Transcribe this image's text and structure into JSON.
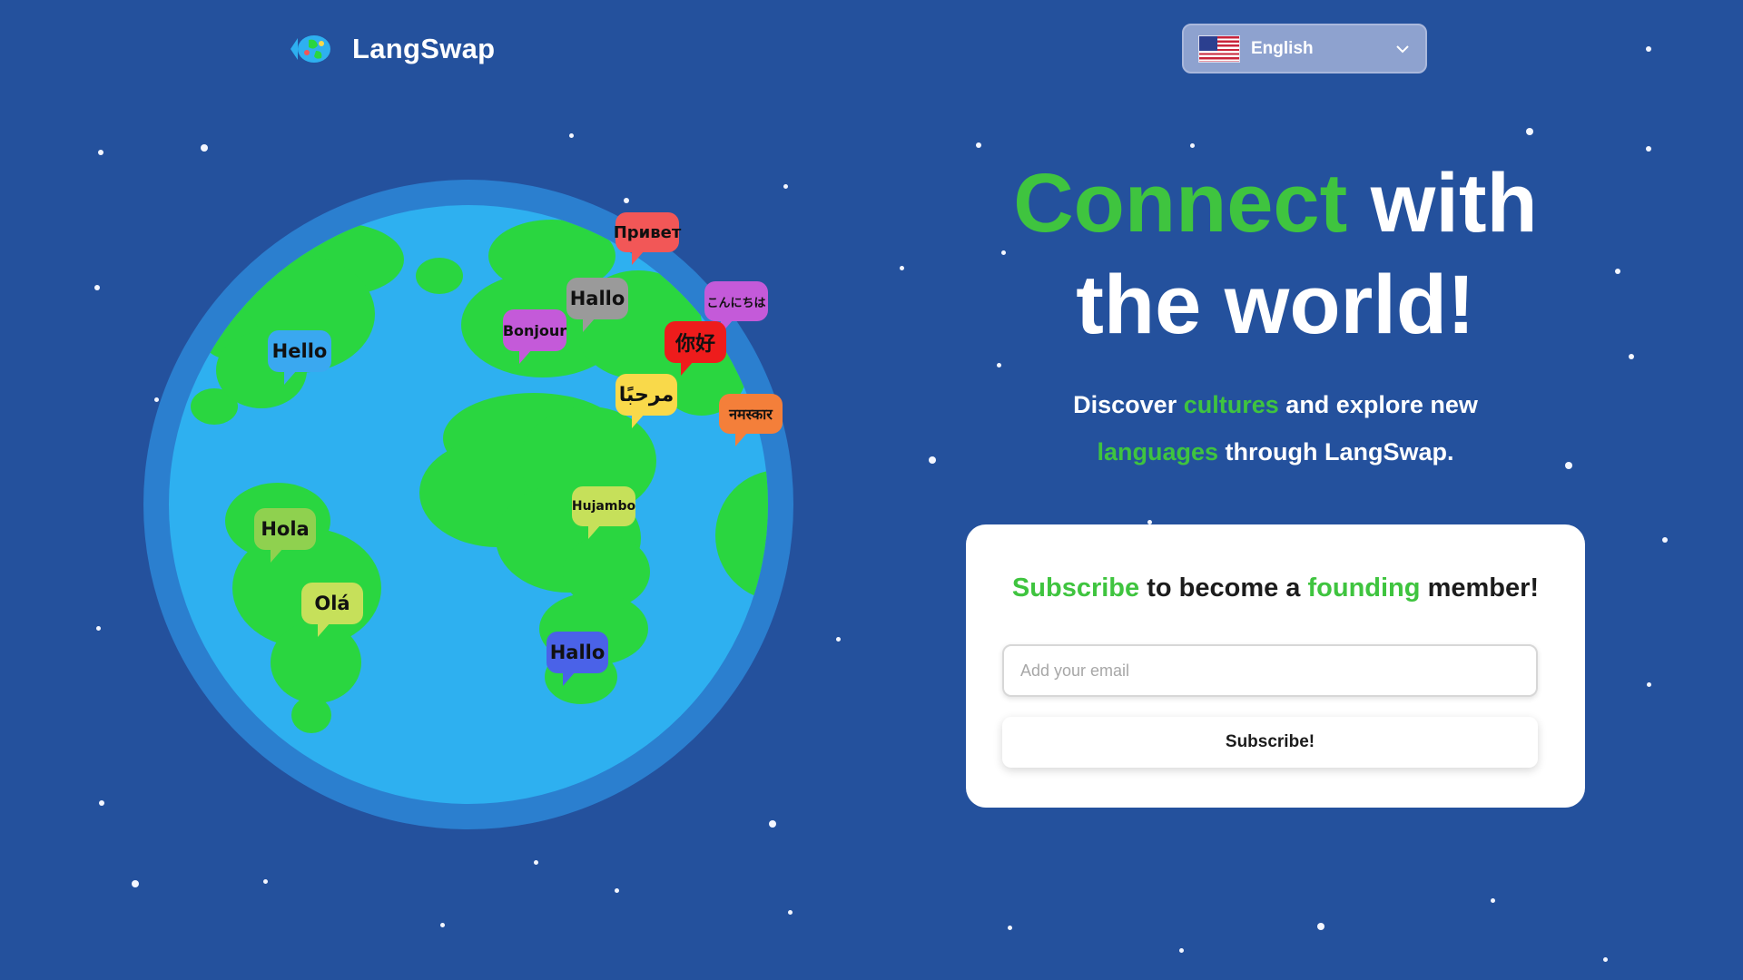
{
  "app": {
    "name": "LangSwap"
  },
  "language_selector": {
    "selected": "English",
    "flag": "us-flag-icon"
  },
  "globe": {
    "greetings": [
      {
        "text": "Привет",
        "color": "#f25757"
      },
      {
        "text": "Hallo",
        "color": "#9a9a9a"
      },
      {
        "text": "こんにちは",
        "color": "#c45ad9"
      },
      {
        "text": "Bonjour",
        "color": "#c45ad9"
      },
      {
        "text": "你好",
        "color": "#ee1c1c"
      },
      {
        "text": "Hello",
        "color": "#3aa8f0"
      },
      {
        "text": "مرحبًا",
        "color": "#f9d94a"
      },
      {
        "text": "नमस्कार",
        "color": "#f47f3a"
      },
      {
        "text": "Hola",
        "color": "#8fd14f"
      },
      {
        "text": "Hujambo",
        "color": "#c6e05a"
      },
      {
        "text": "Olá",
        "color": "#c6e05a"
      },
      {
        "text": "Hallo",
        "color": "#4a62e8"
      }
    ]
  },
  "hero": {
    "title_highlight": "Connect",
    "title_rest_1": "with",
    "title_rest_2": "the world!",
    "sub_1": "Discover",
    "sub_cultures": "cultures",
    "sub_2": "and explore new",
    "sub_languages": "languages",
    "sub_3": "through LangSwap."
  },
  "subscribe": {
    "title_highlight_1": "Subscribe",
    "title_mid": "to become a",
    "title_highlight_2": "founding",
    "title_end": "member!",
    "email_placeholder": "Add your email",
    "button_label": "Subscribe!"
  },
  "colors": {
    "background": "#24519d",
    "accent": "#3fc43f",
    "ocean": "#2eb0f0",
    "land": "#2ad640"
  }
}
